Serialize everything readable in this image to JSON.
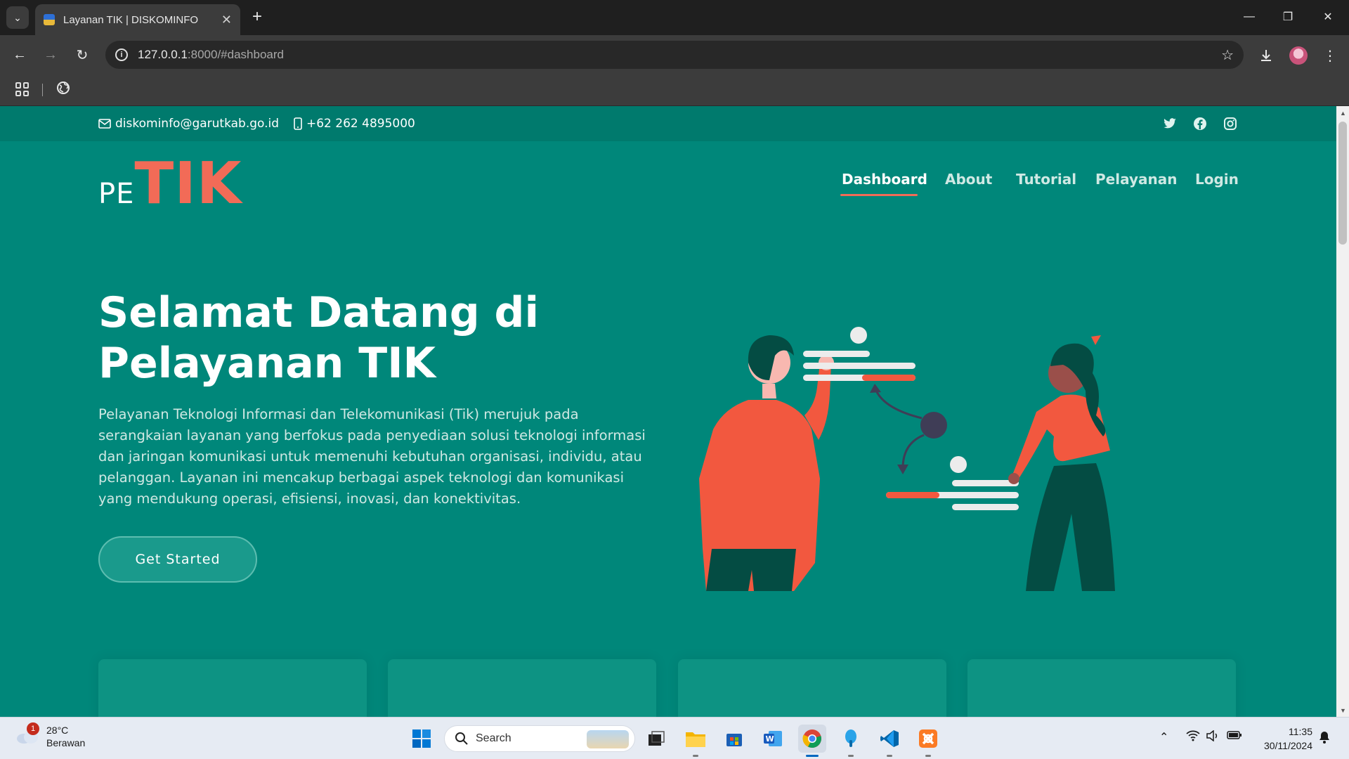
{
  "browser": {
    "tab_title": "Layanan TIK | DISKOMINFO",
    "url_host": "127.0.0.1",
    "url_rest": ":8000/#dashboard"
  },
  "topbar": {
    "email": "diskominfo@garutkab.go.id",
    "phone": "+62 262 4895000",
    "social": [
      "twitter-icon",
      "facebook-icon",
      "instagram-icon"
    ]
  },
  "logo": {
    "prefix": "PE",
    "main": "TIK"
  },
  "nav": {
    "items": [
      {
        "label": "Dashboard",
        "active": true
      },
      {
        "label": "About",
        "active": false
      },
      {
        "label": "Tutorial",
        "active": false
      },
      {
        "label": "Pelayanan",
        "active": false
      },
      {
        "label": "Login",
        "active": false
      }
    ]
  },
  "hero": {
    "title_line1": "Selamat Datang di",
    "title_line2": "Pelayanan TIK",
    "description": "Pelayanan Teknologi Informasi dan Telekomunikasi (Tik) merujuk pada serangkaian layanan yang berfokus pada penyediaan solusi teknologi informasi dan jaringan komunikasi untuk memenuhi kebutuhan organisasi, individu, atau pelanggan. Layanan ini mencakup berbagai aspek teknologi dan komunikasi yang mendukung operasi, efisiensi, inovasi, dan konektivitas.",
    "cta_label": "Get Started"
  },
  "colors": {
    "primary": "#00877a",
    "topbar": "#007a6d",
    "accent": "#f26b57",
    "card": "#0d9383"
  },
  "taskbar": {
    "weather_temp": "28°C",
    "weather_desc": "Berawan",
    "weather_badge": "1",
    "search_label": "Search",
    "time": "11:35",
    "date": "30/11/2024"
  }
}
